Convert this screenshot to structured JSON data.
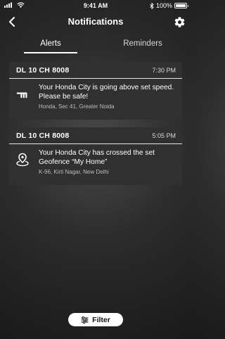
{
  "status_bar": {
    "time": "9:41 AM",
    "battery": "100%",
    "battery_level": 1.0
  },
  "header": {
    "title": "Notifications",
    "back_icon": "chevron-left-icon",
    "settings_icon": "gear-icon"
  },
  "tabs": [
    {
      "label": "Alerts",
      "active": true
    },
    {
      "label": "Reminders",
      "active": false
    }
  ],
  "alerts": [
    {
      "plate": "DL 10 CH 8008",
      "time": "7:30 PM",
      "icon": "speed-arrows-icon",
      "message": "Your Honda City is going above set speed. Please be safe!",
      "location": "Honda, Sec 41, Greater Noida"
    },
    {
      "plate": "DL 10 CH 8008",
      "time": "5:05 PM",
      "icon": "geofence-pin-icon",
      "message": "Your Honda City has crossed the set Geofence “My Home”",
      "location": "K-96, Kirti Nagar, New Delhi"
    }
  ],
  "filter": {
    "label": "Filter",
    "icon": "filter-sliders-icon"
  },
  "colors": {
    "card_bg": "#303030",
    "accent": "#ffffff"
  }
}
